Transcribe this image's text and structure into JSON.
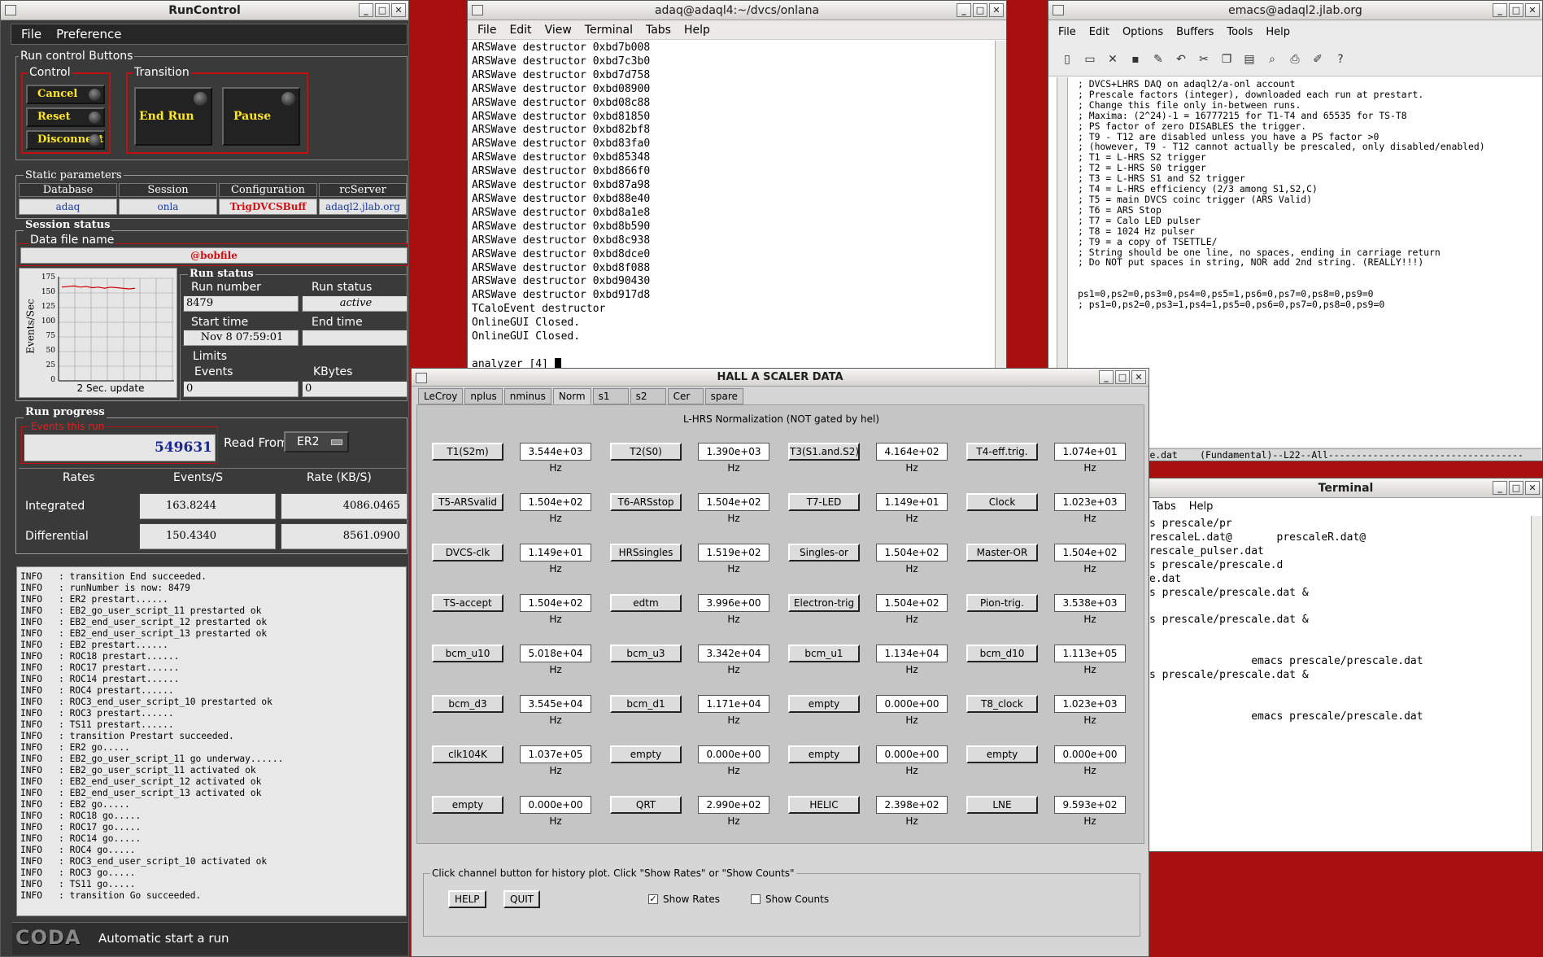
{
  "runcontrol": {
    "title": "RunControl",
    "menu": [
      "File",
      "Preference"
    ],
    "buttons_group": "Run control Buttons",
    "control_label": "Control",
    "transition_label": "Transition",
    "cancel": "Cancel",
    "reset": "Reset",
    "disconnect": "Disconnect",
    "end_run": "End Run",
    "pause": "Pause",
    "static_params": "Static parameters",
    "hdr_database": "Database",
    "hdr_session": "Session",
    "hdr_configuration": "Configuration",
    "hdr_rcserver": "rcServer",
    "database": "adaq",
    "session": "onla",
    "configuration": "TrigDVCSBuff",
    "rcserver": "adaql2.jlab.org",
    "session_status": "Session status",
    "data_file_label": "Data file name",
    "data_file": "@bobfile",
    "graph": {
      "ylabel": "Events/Sec",
      "yticks": [
        "175",
        "150",
        "125",
        "100",
        "75",
        "50",
        "25",
        "0"
      ],
      "caption": "2 Sec. update"
    },
    "run_status_group": "Run status",
    "run_number_label": "Run number",
    "run_number": "8479",
    "run_status_label": "Run status",
    "run_status": "active",
    "start_time_label": "Start time",
    "start_time": "Nov 8 07:59:01",
    "end_time_label": "End time",
    "end_time": "",
    "limits": "Limits",
    "events_label": "Events",
    "events_limit": "0",
    "kbytes_label": "KBytes",
    "kbytes_limit": "0",
    "run_progress": "Run progress",
    "events_this_run_label": "Events this run",
    "events_this_run": "549631",
    "read_from_label": "Read From:",
    "read_from": "ER2",
    "rates_hdr": "Rates",
    "events_s_hdr": "Events/S",
    "rate_kb_hdr": "Rate (KB/S)",
    "integrated": "Integrated",
    "integrated_ev": "163.8244",
    "integrated_kb": "4086.0465",
    "differential": "Differential",
    "differential_ev": "150.4340",
    "differential_kb": "8561.0900",
    "log": "INFO   : transition End succeeded.\nINFO   : runNumber is now: 8479\nINFO   : ER2 prestart......\nINFO   : EB2_go_user_script_11 prestarted ok\nINFO   : EB2_end_user_script_12 prestarted ok\nINFO   : EB2_end_user_script_13 prestarted ok\nINFO   : EB2 prestart......\nINFO   : ROC18 prestart......\nINFO   : ROC17 prestart......\nINFO   : ROC14 prestart......\nINFO   : ROC4 prestart......\nINFO   : ROC3_end_user_script_10 prestarted ok\nINFO   : ROC3 prestart......\nINFO   : TS11 prestart......\nINFO   : transition Prestart succeeded.\nINFO   : ER2 go.....\nINFO   : EB2_go_user_script_11 go underway......\nINFO   : EB2_go_user_script_11 activated ok\nINFO   : EB2_end_user_script_12 activated ok\nINFO   : EB2_end_user_script_13 activated ok\nINFO   : EB2 go.....\nINFO   : ROC18 go.....\nINFO   : ROC17 go.....\nINFO   : ROC14 go.....\nINFO   : ROC4 go.....\nINFO   : ROC3_end_user_script_10 activated ok\nINFO   : ROC3 go.....\nINFO   : TS11 go.....\nINFO   : transition Go succeeded.",
    "coda": "CODA",
    "status": "Automatic start a run"
  },
  "terminal": {
    "title": "adaq@adaql4:~/dvcs/onlana",
    "menu": [
      "File",
      "Edit",
      "View",
      "Terminal",
      "Tabs",
      "Help"
    ],
    "text": "ARSWave destructor 0xbd7b008\nARSWave destructor 0xbd7c3b0\nARSWave destructor 0xbd7d758\nARSWave destructor 0xbd08900\nARSWave destructor 0xbd08c88\nARSWave destructor 0xbd81850\nARSWave destructor 0xbd82bf8\nARSWave destructor 0xbd83fa0\nARSWave destructor 0xbd85348\nARSWave destructor 0xbd866f0\nARSWave destructor 0xbd87a98\nARSWave destructor 0xbd88e40\nARSWave destructor 0xbd8a1e8\nARSWave destructor 0xbd8b590\nARSWave destructor 0xbd8c938\nARSWave destructor 0xbd8dce0\nARSWave destructor 0xbd8f088\nARSWave destructor 0xbd90430\nARSWave destructor 0xbd917d8\nTCaloEvent destructor\nOnlineGUI Closed.\nOnlineGUI Closed.\n\nanalyzer [4] "
  },
  "emacs": {
    "title": "emacs@adaql2.jlab.org",
    "menu": [
      "File",
      "Edit",
      "Options",
      "Buffers",
      "Tools",
      "Help"
    ],
    "text": "; DVCS+LHRS DAQ on adaql2/a-onl account\n; Prescale factors (integer), downloaded each run at prestart.\n; Change this file only in-between runs.\n; Maxima: (2^24)-1 = 16777215 for T1-T4 and 65535 for TS-T8\n; PS factor of zero DISABLES the trigger.\n; T9 - T12 are disabled unless you have a PS factor >0\n; (however, T9 - T12 cannot actually be prescaled, only disabled/enabled)\n; T1 = L-HRS S2 trigger\n; T2 = L-HRS S0 trigger\n; T3 = L-HRS S1 and S2 trigger\n; T4 = L-HRS efficiency (2/3 among S1,S2,C)\n; T5 = main DVCS coinc trigger (ARS Valid)\n; T6 = ARS Stop\n; T7 = Calo LED pulser\n; T8 = 1024 Hz pulser\n; T9 = a copy of TSETTLE/\n; String should be one line, no spaces, ending in carriage return\n; Do NOT put spaces in string, NOR add 2nd string. (REALLY!!!)\n\n\nps1=0,ps2=0,ps3=0,ps4=0,ps5=1,ps6=0,ps7=0,ps8=0,ps9=0\n; ps1=0,ps2=0,ps3=1,ps4=1,ps5=0,ps6=0,ps7=0,ps8=0,ps9=0",
    "modeline": "     -:--  prescale.dat    (Fundamental)--L22--All-----------------------------------"
  },
  "terminal2": {
    "title": "Terminal",
    "menu": [
      "Tabs",
      "Help"
    ],
    "text": "s prescale/pr\nrescaleL.dat@       prescaleR.dat@\nrescale_pulser.dat\ns prescale/prescale.d\ne.dat\ns prescale/prescale.dat &\n\ns prescale/prescale.dat &\n\n\n                emacs prescale/prescale.dat\ns prescale/prescale.dat &\n\n\n                emacs prescale/prescale.dat"
  },
  "scaler": {
    "title": "HALL A SCALER DATA",
    "tabs": [
      "LeCroy",
      "nplus",
      "nminus",
      "Norm",
      "s1",
      "s2",
      "Cer",
      "spare"
    ],
    "active_tab": "Norm",
    "heading": "L-HRS Normalization (NOT gated by hel)",
    "rows": [
      [
        [
          "T1(S2m)",
          "3.544e+03 Hz"
        ],
        [
          "T2(S0)",
          "1.390e+03 Hz"
        ],
        [
          "T3(S1.and.S2)",
          "4.164e+02 Hz"
        ],
        [
          "T4-eff.trig.",
          "1.074e+01 Hz"
        ]
      ],
      [
        [
          "T5-ARSvalid",
          "1.504e+02 Hz"
        ],
        [
          "T6-ARSstop",
          "1.504e+02 Hz"
        ],
        [
          "T7-LED",
          "1.149e+01 Hz"
        ],
        [
          "Clock",
          "1.023e+03 Hz"
        ]
      ],
      [
        [
          "DVCS-clk",
          "1.149e+01 Hz"
        ],
        [
          "HRSsingles",
          "1.519e+02 Hz"
        ],
        [
          "Singles-or",
          "1.504e+02 Hz"
        ],
        [
          "Master-OR",
          "1.504e+02 Hz"
        ]
      ],
      [
        [
          "TS-accept",
          "1.504e+02 Hz"
        ],
        [
          "edtm",
          "3.996e+00 Hz"
        ],
        [
          "Electron-trig",
          "1.504e+02 Hz"
        ],
        [
          "Pion-trig.",
          "3.538e+03 Hz"
        ]
      ],
      [
        [
          "bcm_u10",
          "5.018e+04 Hz"
        ],
        [
          "bcm_u3",
          "3.342e+04 Hz"
        ],
        [
          "bcm_u1",
          "1.134e+04 Hz"
        ],
        [
          "bcm_d10",
          "1.113e+05 Hz"
        ]
      ],
      [
        [
          "bcm_d3",
          "3.545e+04 Hz"
        ],
        [
          "bcm_d1",
          "1.171e+04 Hz"
        ],
        [
          "empty",
          "0.000e+00 Hz"
        ],
        [
          "T8_clock",
          "1.023e+03 Hz"
        ]
      ],
      [
        [
          "clk104K",
          "1.037e+05 Hz"
        ],
        [
          "empty",
          "0.000e+00 Hz"
        ],
        [
          "empty",
          "0.000e+00 Hz"
        ],
        [
          "empty",
          "0.000e+00 Hz"
        ]
      ],
      [
        [
          "empty",
          "0.000e+00 Hz"
        ],
        [
          "QRT",
          "2.990e+02 Hz"
        ],
        [
          "HELIC",
          "2.398e+02 Hz"
        ],
        [
          "LNE",
          "9.593e+02 Hz"
        ]
      ]
    ],
    "hint": "Click channel button for history plot.  Click \"Show Rates\" or \"Show Counts\"",
    "help": "HELP",
    "quit": "QUIT",
    "show_rates": "Show Rates",
    "show_counts": "Show Counts",
    "check_mark": "✓"
  }
}
